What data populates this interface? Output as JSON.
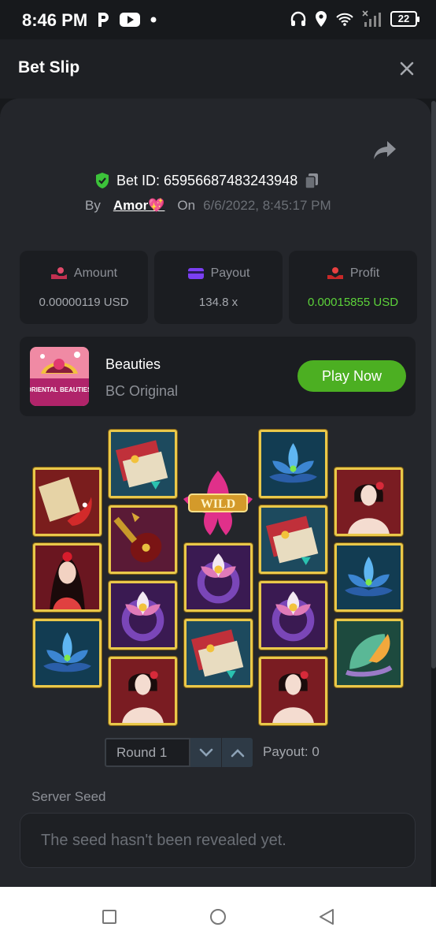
{
  "status_bar": {
    "time": "8:46 PM",
    "battery": "22"
  },
  "header": {
    "title": "Bet Slip"
  },
  "bet": {
    "id_label": "Bet ID: 65956687483243948",
    "by_label": "By",
    "user": "Amor💖",
    "on_label": "On",
    "date": "6/6/2022, 8:45:17 PM"
  },
  "stats": [
    {
      "label": "Amount",
      "value": "0.00000119 USD"
    },
    {
      "label": "Payout",
      "value": "134.8 x"
    },
    {
      "label": "Profit",
      "value": "0.00015855 USD"
    }
  ],
  "game": {
    "name": "Beauties",
    "subtitle": "BC Original",
    "play_label": "Play Now",
    "thumb_title": "ORIENTAL BEAUTIES"
  },
  "reels": {
    "wild_text": "WILD",
    "columns": [
      [
        "scroll",
        "lady-red",
        "lotus-blue"
      ],
      [
        "book",
        "pipa",
        "ring-lotus",
        "lady-white"
      ],
      [
        "wild",
        "ring-lotus",
        "book"
      ],
      [
        "lotus-blue",
        "book",
        "ring-lotus",
        "lady-white"
      ],
      [
        "lady-white",
        "lotus-blue",
        "fan"
      ]
    ]
  },
  "round": {
    "selected": "Round 1",
    "payout": "Payout: 0"
  },
  "seed": {
    "label": "Server Seed",
    "message": "The seed hasn't been revealed yet."
  },
  "colors": {
    "accent_green": "#4caf22",
    "profit_green": "#5cd23a",
    "tile_border": "#e9c84a"
  }
}
